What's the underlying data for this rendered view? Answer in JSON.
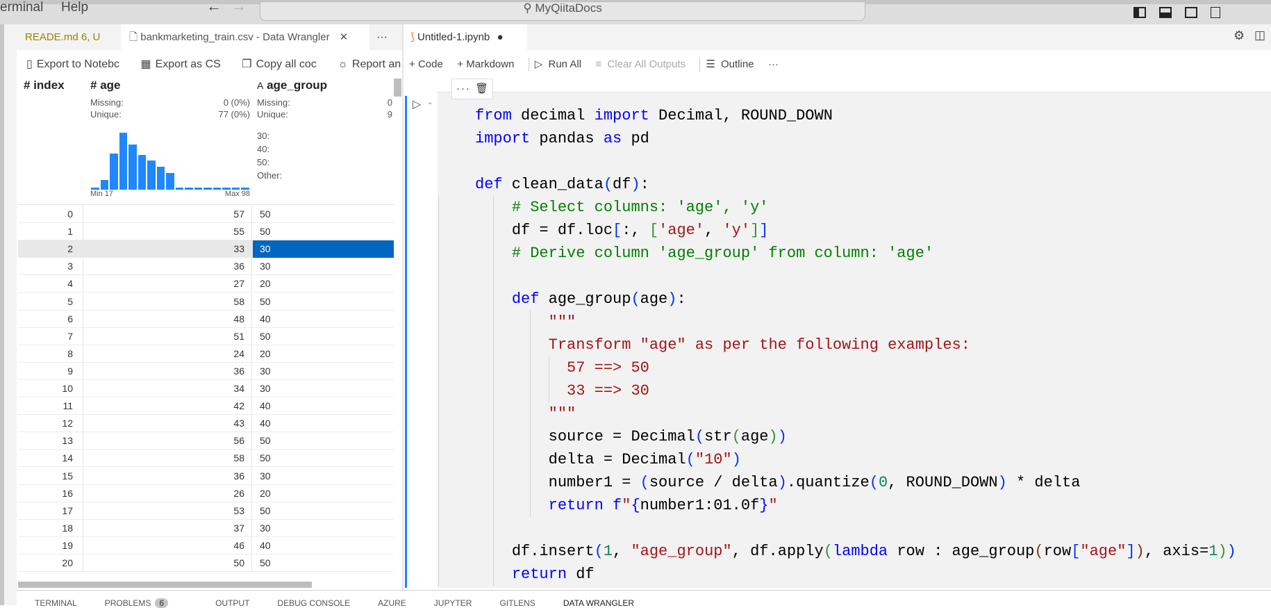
{
  "menu": {
    "items": [
      "erminal",
      "Help"
    ],
    "back": "←",
    "forward": "→",
    "search": "MyQiitaDocs"
  },
  "left_editor": {
    "tabs": [
      {
        "label": "READE.md",
        "badge": "6, U"
      },
      {
        "label": "bankmarketing_train.csv - Data Wrangler",
        "close": "✕"
      }
    ],
    "more": "···",
    "toolbar": [
      {
        "icon": "notebook-icon",
        "label": "Export to Notebc"
      },
      {
        "icon": "table-icon",
        "label": "Export as CS"
      },
      {
        "icon": "copy-icon",
        "label": "Copy all coc"
      },
      {
        "icon": "bug-icon",
        "label": "Report an iss"
      }
    ],
    "columns": [
      {
        "type": "#",
        "name": "index"
      },
      {
        "type": "#",
        "name": "age",
        "missing_label": "Missing:",
        "missing": "0 (0%)",
        "unique_label": "Unique:",
        "unique": "77 (0%)",
        "hist_min": "Min 17",
        "hist_max": "Max 98"
      },
      {
        "type": "A",
        "name": "age_group",
        "missing_label": "Missing:",
        "missing": "0",
        "unique_label": "Unique:",
        "unique": "9",
        "top_values": [
          "30:",
          "40:",
          "50:",
          "Other:"
        ]
      }
    ],
    "histogram_relative": [
      3,
      17,
      63,
      100,
      79,
      61,
      51,
      40,
      29,
      3,
      3,
      3,
      3,
      3,
      3,
      3,
      3
    ],
    "rows": [
      [
        "0",
        "57",
        "50"
      ],
      [
        "1",
        "55",
        "50"
      ],
      [
        "2",
        "33",
        "30"
      ],
      [
        "3",
        "36",
        "30"
      ],
      [
        "4",
        "27",
        "20"
      ],
      [
        "5",
        "58",
        "50"
      ],
      [
        "6",
        "48",
        "40"
      ],
      [
        "7",
        "51",
        "50"
      ],
      [
        "8",
        "24",
        "20"
      ],
      [
        "9",
        "36",
        "30"
      ],
      [
        "10",
        "34",
        "30"
      ],
      [
        "11",
        "42",
        "40"
      ],
      [
        "12",
        "43",
        "40"
      ],
      [
        "13",
        "56",
        "50"
      ],
      [
        "14",
        "58",
        "50"
      ],
      [
        "15",
        "36",
        "30"
      ],
      [
        "16",
        "26",
        "20"
      ],
      [
        "17",
        "53",
        "50"
      ],
      [
        "18",
        "37",
        "30"
      ],
      [
        "19",
        "46",
        "40"
      ],
      [
        "20",
        "50",
        "50"
      ]
    ],
    "selected_row": 2
  },
  "notebook": {
    "tab": "Untitled-1.ipynb",
    "dirty": "●",
    "toolbar": {
      "code": "Code",
      "markdown": "Markdown",
      "run_all": "Run All",
      "clear": "Clear All Outputs",
      "outline": "Outline",
      "more": "···"
    },
    "cell_more": "···",
    "code": [
      {
        "i": 0,
        "t": [
          [
            "kw",
            "from"
          ],
          [
            "tx",
            " decimal "
          ],
          [
            "kw",
            "import"
          ],
          [
            "tx",
            " Decimal, ROUND_DOWN"
          ]
        ]
      },
      {
        "i": 0,
        "t": [
          [
            "kw",
            "import"
          ],
          [
            "tx",
            " pandas "
          ],
          [
            "kw",
            "as"
          ],
          [
            "tx",
            " pd"
          ]
        ]
      },
      {
        "i": 0,
        "t": []
      },
      {
        "i": 0,
        "t": [
          [
            "kw",
            "def"
          ],
          [
            "tx",
            " clean_data"
          ],
          [
            "b1",
            "("
          ],
          [
            "tx",
            "df"
          ],
          [
            "b1",
            ")"
          ],
          [
            "tx",
            ":"
          ]
        ]
      },
      {
        "i": 4,
        "t": [
          [
            "cm",
            "# Select columns: 'age', 'y'"
          ]
        ]
      },
      {
        "i": 4,
        "t": [
          [
            "tx",
            "df = df.loc"
          ],
          [
            "b1",
            "["
          ],
          [
            "tx",
            ":, "
          ],
          [
            "b2",
            "["
          ],
          [
            "str",
            "'age'"
          ],
          [
            "tx",
            ", "
          ],
          [
            "str",
            "'y'"
          ],
          [
            "b2",
            "]"
          ],
          [
            "b1",
            "]"
          ]
        ]
      },
      {
        "i": 4,
        "t": [
          [
            "cm",
            "# Derive column 'age_group' from column: 'age'"
          ]
        ]
      },
      {
        "i": 4,
        "t": []
      },
      {
        "i": 4,
        "t": [
          [
            "kw",
            "def"
          ],
          [
            "tx",
            " age_group"
          ],
          [
            "b1",
            "("
          ],
          [
            "tx",
            "age"
          ],
          [
            "b1",
            ")"
          ],
          [
            "tx",
            ":"
          ]
        ]
      },
      {
        "i": 8,
        "t": [
          [
            "str",
            "\"\"\""
          ]
        ]
      },
      {
        "i": 8,
        "t": [
          [
            "str",
            "Transform \"age\" as per the following examples:"
          ]
        ]
      },
      {
        "i": 10,
        "t": [
          [
            "str",
            "57 ==> 50"
          ]
        ]
      },
      {
        "i": 10,
        "t": [
          [
            "str",
            "33 ==> 30"
          ]
        ]
      },
      {
        "i": 8,
        "t": [
          [
            "str",
            "\"\"\""
          ]
        ]
      },
      {
        "i": 8,
        "t": [
          [
            "tx",
            "source = Decimal"
          ],
          [
            "b1",
            "("
          ],
          [
            "tx",
            "str"
          ],
          [
            "b2",
            "("
          ],
          [
            "tx",
            "age"
          ],
          [
            "b2",
            ")"
          ],
          [
            "b1",
            ")"
          ]
        ]
      },
      {
        "i": 8,
        "t": [
          [
            "tx",
            "delta = Decimal"
          ],
          [
            "b1",
            "("
          ],
          [
            "str",
            "\"10\""
          ],
          [
            "b1",
            ")"
          ]
        ]
      },
      {
        "i": 8,
        "t": [
          [
            "tx",
            "number1 = "
          ],
          [
            "b1",
            "("
          ],
          [
            "tx",
            "source / delta"
          ],
          [
            "b1",
            ")"
          ],
          [
            "tx",
            ".quantize"
          ],
          [
            "b1",
            "("
          ],
          [
            "num",
            "0"
          ],
          [
            "tx",
            ", ROUND_DOWN"
          ],
          [
            "b1",
            ")"
          ],
          [
            "tx",
            " * delta"
          ]
        ]
      },
      {
        "i": 8,
        "t": [
          [
            "kw",
            "return"
          ],
          [
            "tx",
            " "
          ],
          [
            "kw",
            "f"
          ],
          [
            "str",
            "\""
          ],
          [
            "kw",
            "{"
          ],
          [
            "tx",
            "number1:01.0f"
          ],
          [
            "kw",
            "}"
          ],
          [
            "str",
            "\""
          ]
        ]
      },
      {
        "i": 4,
        "t": []
      },
      {
        "i": 4,
        "t": [
          [
            "tx",
            "df.insert"
          ],
          [
            "b1",
            "("
          ],
          [
            "num",
            "1"
          ],
          [
            "tx",
            ", "
          ],
          [
            "str",
            "\"age_group\""
          ],
          [
            "tx",
            ", df.apply"
          ],
          [
            "b2",
            "("
          ],
          [
            "kw",
            "lambda"
          ],
          [
            "tx",
            " row : age_group"
          ],
          [
            "b3",
            "("
          ],
          [
            "tx",
            "row"
          ],
          [
            "b1",
            "["
          ],
          [
            "str",
            "\"age\""
          ],
          [
            "b1",
            "]"
          ],
          [
            "b3",
            ")"
          ],
          [
            "tx",
            ", axis="
          ],
          [
            "num",
            "1"
          ],
          [
            "b2",
            ")"
          ],
          [
            "b1",
            ")"
          ]
        ]
      },
      {
        "i": 4,
        "t": [
          [
            "kw",
            "return"
          ],
          [
            "tx",
            " df"
          ]
        ]
      }
    ]
  },
  "panel_tabs": [
    {
      "label": "TERMINAL"
    },
    {
      "label": "PROBLEMS",
      "badge": "6"
    },
    {
      "label": "OUTPUT"
    },
    {
      "label": "DEBUG CONSOLE"
    },
    {
      "label": "AZURE"
    },
    {
      "label": "JUPYTER"
    },
    {
      "label": "GITLENS"
    },
    {
      "label": "DATA WRANGLER"
    }
  ],
  "colors": {
    "accent": "#1a85ff",
    "selected_cell": "#0066c0",
    "histogram": "#1f87ff"
  }
}
